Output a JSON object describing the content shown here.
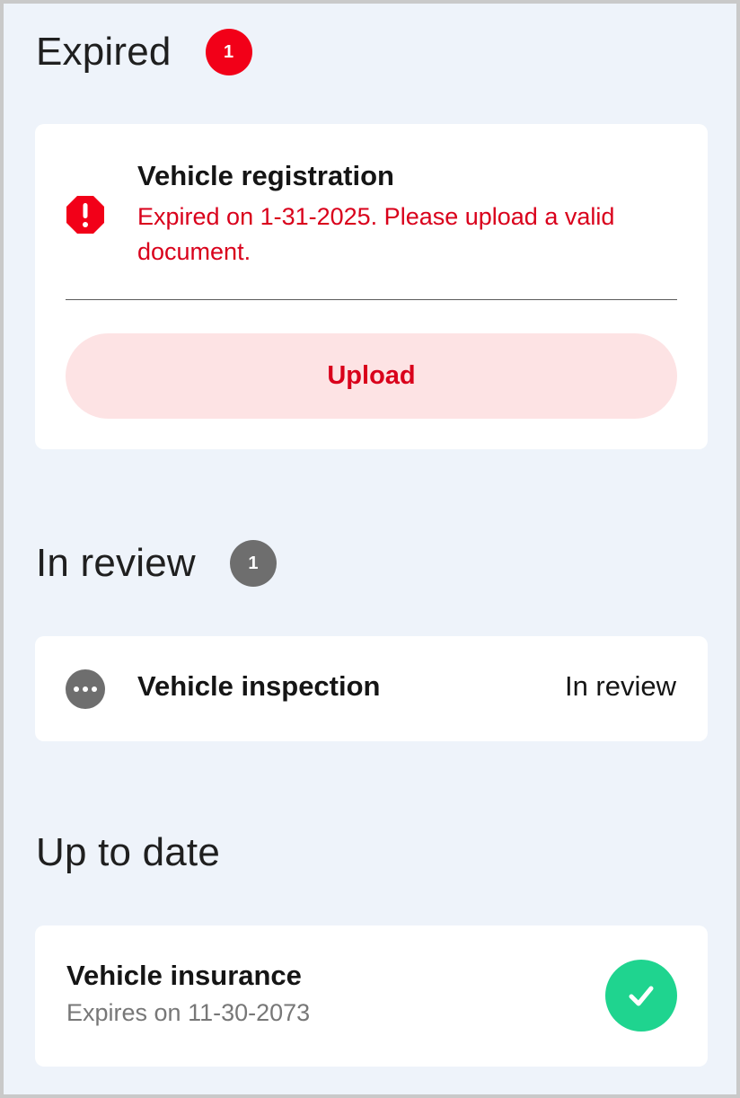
{
  "sections": {
    "expired": {
      "title": "Expired",
      "count": "1",
      "badge_color": "#f20018",
      "item": {
        "title": "Vehicle registration",
        "message": "Expired on 1-31-2025.  Please upload a valid document.",
        "icon": "alert-octagon-icon",
        "button_label": "Upload"
      }
    },
    "in_review": {
      "title": "In review",
      "count": "1",
      "badge_color": "#6e6e6e",
      "item": {
        "title": "Vehicle inspection",
        "status": "In review",
        "icon": "more-dots-icon"
      }
    },
    "up_to_date": {
      "title": "Up to date",
      "item": {
        "title": "Vehicle insurance",
        "subtitle": "Expires on 11-30-2073",
        "icon": "check-circle-icon",
        "icon_color": "#1fd48f"
      }
    }
  },
  "colors": {
    "background": "#eef3fa",
    "error_text": "#d9001b",
    "upload_button_bg": "#fde3e4"
  }
}
